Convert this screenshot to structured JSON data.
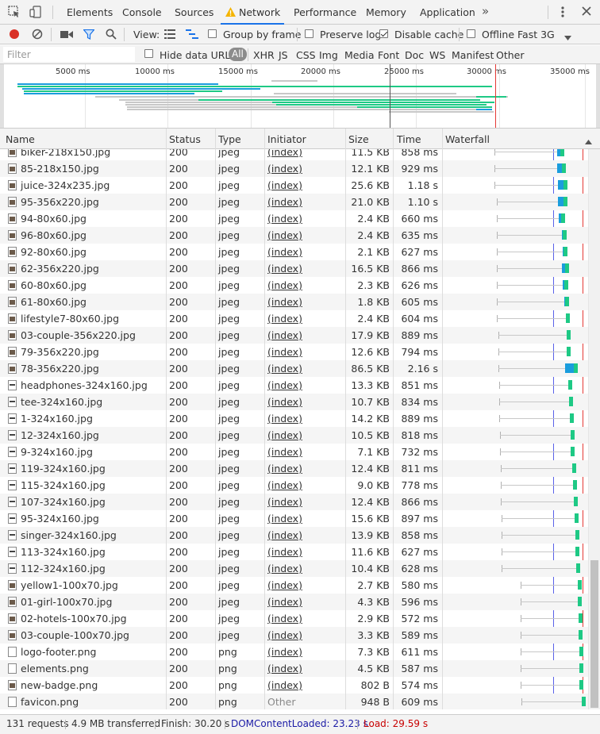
{
  "tabbar": {
    "tabs": [
      "Elements",
      "Console",
      "Sources",
      "Network",
      "Performance",
      "Memory",
      "Application"
    ],
    "active": "Network",
    "more_icon": "chevron-double-right-icon",
    "menu_icon": "kebab-menu-icon",
    "close_icon": "close-icon"
  },
  "toolbar": {
    "view_label": "View:",
    "group_by_frame": "Group by frame",
    "preserve_log": "Preserve log",
    "disable_cache": "Disable cache",
    "offline": "Offline",
    "throttle": "Fast 3G"
  },
  "filterbar": {
    "placeholder": "Filter",
    "hide_data_urls": "Hide data URLs",
    "types": [
      "All",
      "XHR",
      "JS",
      "CSS",
      "Img",
      "Media",
      "Font",
      "Doc",
      "WS",
      "Manifest",
      "Other"
    ]
  },
  "overview": {
    "ticks": [
      "5000 ms",
      "10000 ms",
      "15000 ms",
      "20000 ms",
      "25000 ms",
      "30000 ms",
      "35000 ms"
    ]
  },
  "columns": [
    "Name",
    "Status",
    "Type",
    "Initiator",
    "Size",
    "Time",
    "Waterfall"
  ],
  "rows": [
    {
      "name": "biker-218x150.jpg",
      "status": "200",
      "type": "jpeg",
      "initiator": "(index)",
      "size": "11.5 KB",
      "time": "858 ms"
    },
    {
      "name": "85-218x150.jpg",
      "status": "200",
      "type": "jpeg",
      "initiator": "(index)",
      "size": "12.1 KB",
      "time": "929 ms"
    },
    {
      "name": "juice-324x235.jpg",
      "status": "200",
      "type": "jpeg",
      "initiator": "(index)",
      "size": "25.6 KB",
      "time": "1.18 s"
    },
    {
      "name": "95-356x220.jpg",
      "status": "200",
      "type": "jpeg",
      "initiator": "(index)",
      "size": "21.0 KB",
      "time": "1.10 s"
    },
    {
      "name": "94-80x60.jpg",
      "status": "200",
      "type": "jpeg",
      "initiator": "(index)",
      "size": "2.4 KB",
      "time": "660 ms"
    },
    {
      "name": "96-80x60.jpg",
      "status": "200",
      "type": "jpeg",
      "initiator": "(index)",
      "size": "2.4 KB",
      "time": "635 ms"
    },
    {
      "name": "92-80x60.jpg",
      "status": "200",
      "type": "jpeg",
      "initiator": "(index)",
      "size": "2.1 KB",
      "time": "627 ms"
    },
    {
      "name": "62-356x220.jpg",
      "status": "200",
      "type": "jpeg",
      "initiator": "(index)",
      "size": "16.5 KB",
      "time": "866 ms"
    },
    {
      "name": "60-80x60.jpg",
      "status": "200",
      "type": "jpeg",
      "initiator": "(index)",
      "size": "2.3 KB",
      "time": "626 ms"
    },
    {
      "name": "61-80x60.jpg",
      "status": "200",
      "type": "jpeg",
      "initiator": "(index)",
      "size": "1.8 KB",
      "time": "605 ms"
    },
    {
      "name": "lifestyle7-80x60.jpg",
      "status": "200",
      "type": "jpeg",
      "initiator": "(index)",
      "size": "2.4 KB",
      "time": "604 ms"
    },
    {
      "name": "03-couple-356x220.jpg",
      "status": "200",
      "type": "jpeg",
      "initiator": "(index)",
      "size": "17.9 KB",
      "time": "889 ms"
    },
    {
      "name": "79-356x220.jpg",
      "status": "200",
      "type": "jpeg",
      "initiator": "(index)",
      "size": "12.6 KB",
      "time": "794 ms"
    },
    {
      "name": "78-356x220.jpg",
      "status": "200",
      "type": "jpeg",
      "initiator": "(index)",
      "size": "86.5 KB",
      "time": "2.16 s"
    },
    {
      "name": "headphones-324x160.jpg",
      "status": "200",
      "type": "jpeg",
      "initiator": "(index)",
      "size": "13.3 KB",
      "time": "851 ms"
    },
    {
      "name": "tee-324x160.jpg",
      "status": "200",
      "type": "jpeg",
      "initiator": "(index)",
      "size": "10.7 KB",
      "time": "834 ms"
    },
    {
      "name": "1-324x160.jpg",
      "status": "200",
      "type": "jpeg",
      "initiator": "(index)",
      "size": "14.2 KB",
      "time": "889 ms"
    },
    {
      "name": "12-324x160.jpg",
      "status": "200",
      "type": "jpeg",
      "initiator": "(index)",
      "size": "10.5 KB",
      "time": "818 ms"
    },
    {
      "name": "9-324x160.jpg",
      "status": "200",
      "type": "jpeg",
      "initiator": "(index)",
      "size": "7.1 KB",
      "time": "732 ms"
    },
    {
      "name": "119-324x160.jpg",
      "status": "200",
      "type": "jpeg",
      "initiator": "(index)",
      "size": "12.4 KB",
      "time": "811 ms"
    },
    {
      "name": "115-324x160.jpg",
      "status": "200",
      "type": "jpeg",
      "initiator": "(index)",
      "size": "9.0 KB",
      "time": "778 ms"
    },
    {
      "name": "107-324x160.jpg",
      "status": "200",
      "type": "jpeg",
      "initiator": "(index)",
      "size": "12.4 KB",
      "time": "866 ms"
    },
    {
      "name": "95-324x160.jpg",
      "status": "200",
      "type": "jpeg",
      "initiator": "(index)",
      "size": "15.6 KB",
      "time": "897 ms"
    },
    {
      "name": "singer-324x160.jpg",
      "status": "200",
      "type": "jpeg",
      "initiator": "(index)",
      "size": "13.9 KB",
      "time": "858 ms"
    },
    {
      "name": "113-324x160.jpg",
      "status": "200",
      "type": "jpeg",
      "initiator": "(index)",
      "size": "11.6 KB",
      "time": "627 ms"
    },
    {
      "name": "112-324x160.jpg",
      "status": "200",
      "type": "jpeg",
      "initiator": "(index)",
      "size": "10.4 KB",
      "time": "628 ms"
    },
    {
      "name": "yellow1-100x70.jpg",
      "status": "200",
      "type": "jpeg",
      "initiator": "(index)",
      "size": "2.7 KB",
      "time": "580 ms"
    },
    {
      "name": "01-girl-100x70.jpg",
      "status": "200",
      "type": "jpeg",
      "initiator": "(index)",
      "size": "4.3 KB",
      "time": "596 ms"
    },
    {
      "name": "02-hotels-100x70.jpg",
      "status": "200",
      "type": "jpeg",
      "initiator": "(index)",
      "size": "2.9 KB",
      "time": "572 ms"
    },
    {
      "name": "03-couple-100x70.jpg",
      "status": "200",
      "type": "jpeg",
      "initiator": "(index)",
      "size": "3.3 KB",
      "time": "589 ms"
    },
    {
      "name": "logo-footer.png",
      "status": "200",
      "type": "png",
      "initiator": "(index)",
      "size": "7.3 KB",
      "time": "611 ms"
    },
    {
      "name": "elements.png",
      "status": "200",
      "type": "png",
      "initiator": "(index)",
      "size": "4.5 KB",
      "time": "587 ms"
    },
    {
      "name": "new-badge.png",
      "status": "200",
      "type": "png",
      "initiator": "(index)",
      "size": "802 B",
      "time": "574 ms"
    },
    {
      "name": "favicon.png",
      "status": "200",
      "type": "png",
      "initiator": "Other",
      "size": "948 B",
      "time": "609 ms"
    }
  ],
  "status": {
    "requests": "131 requests",
    "transferred": "4.9 MB transferred",
    "finish": "Finish: 30.20 s",
    "dom": "DOMContentLoaded: 23.23 s",
    "load": "Load: 29.59 s",
    "dom_color": "#1a1aa6",
    "load_color": "#c80000"
  },
  "colors": {
    "waiting": "#1a9ddd",
    "download": "#1ec985",
    "active_tab": "#1a73e8",
    "record": "#d93025"
  }
}
